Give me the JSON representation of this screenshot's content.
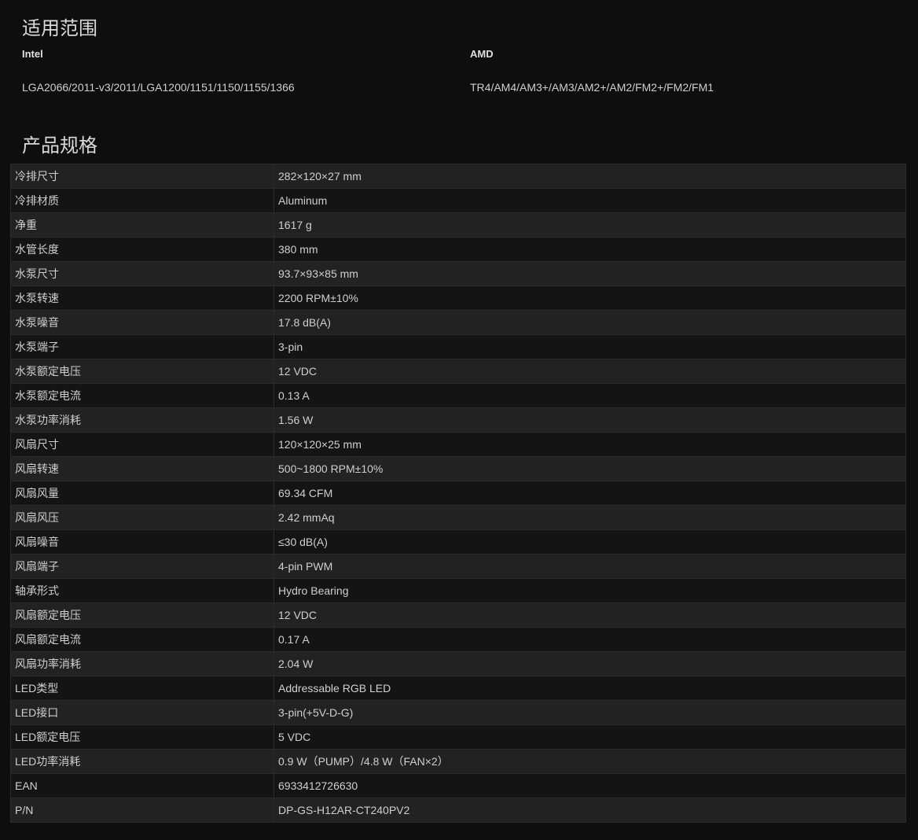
{
  "compat": {
    "title": "适用范围",
    "intel": {
      "label": "Intel",
      "sockets": "LGA2066/2011-v3/2011/LGA1200/1151/1150/1155/1366"
    },
    "amd": {
      "label": "AMD",
      "sockets": "TR4/AM4/AM3+/AM3/AM2+/AM2/FM2+/FM2/FM1"
    }
  },
  "specs": {
    "title": "产品规格",
    "rows": [
      {
        "key": "冷排尺寸",
        "value": "282×120×27 mm"
      },
      {
        "key": "冷排材质",
        "value": "Aluminum"
      },
      {
        "key": "净重",
        "value": "1617 g"
      },
      {
        "key": "水管长度",
        "value": "380 mm"
      },
      {
        "key": "水泵尺寸",
        "value": "93.7×93×85 mm"
      },
      {
        "key": "水泵转速",
        "value": "2200 RPM±10%"
      },
      {
        "key": "水泵噪音",
        "value": "17.8 dB(A)"
      },
      {
        "key": "水泵端子",
        "value": "3-pin"
      },
      {
        "key": "水泵额定电压",
        "value": "12 VDC"
      },
      {
        "key": "水泵额定电流",
        "value": "0.13 A"
      },
      {
        "key": "水泵功率消耗",
        "value": "1.56 W"
      },
      {
        "key": "风扇尺寸",
        "value": "120×120×25 mm"
      },
      {
        "key": "风扇转速",
        "value": "500~1800 RPM±10%"
      },
      {
        "key": "风扇风量",
        "value": "69.34 CFM"
      },
      {
        "key": "风扇风压",
        "value": "2.42 mmAq"
      },
      {
        "key": "风扇噪音",
        "value": "≤30 dB(A)"
      },
      {
        "key": "风扇端子",
        "value": "4-pin PWM"
      },
      {
        "key": "轴承形式",
        "value": "Hydro Bearing"
      },
      {
        "key": "风扇额定电压",
        "value": "12 VDC"
      },
      {
        "key": "风扇额定电流",
        "value": "0.17 A"
      },
      {
        "key": "风扇功率消耗",
        "value": "2.04 W"
      },
      {
        "key": "LED类型",
        "value": "Addressable RGB LED"
      },
      {
        "key": "LED接口",
        "value": "3-pin(+5V-D-G)"
      },
      {
        "key": "LED额定电压",
        "value": "5 VDC"
      },
      {
        "key": "LED功率消耗",
        "value": "0.9 W（PUMP）/4.8 W（FAN×2）"
      },
      {
        "key": "EAN",
        "value": "6933412726630"
      },
      {
        "key": "P/N",
        "value": "DP-GS-H12AR-CT240PV2"
      }
    ]
  }
}
